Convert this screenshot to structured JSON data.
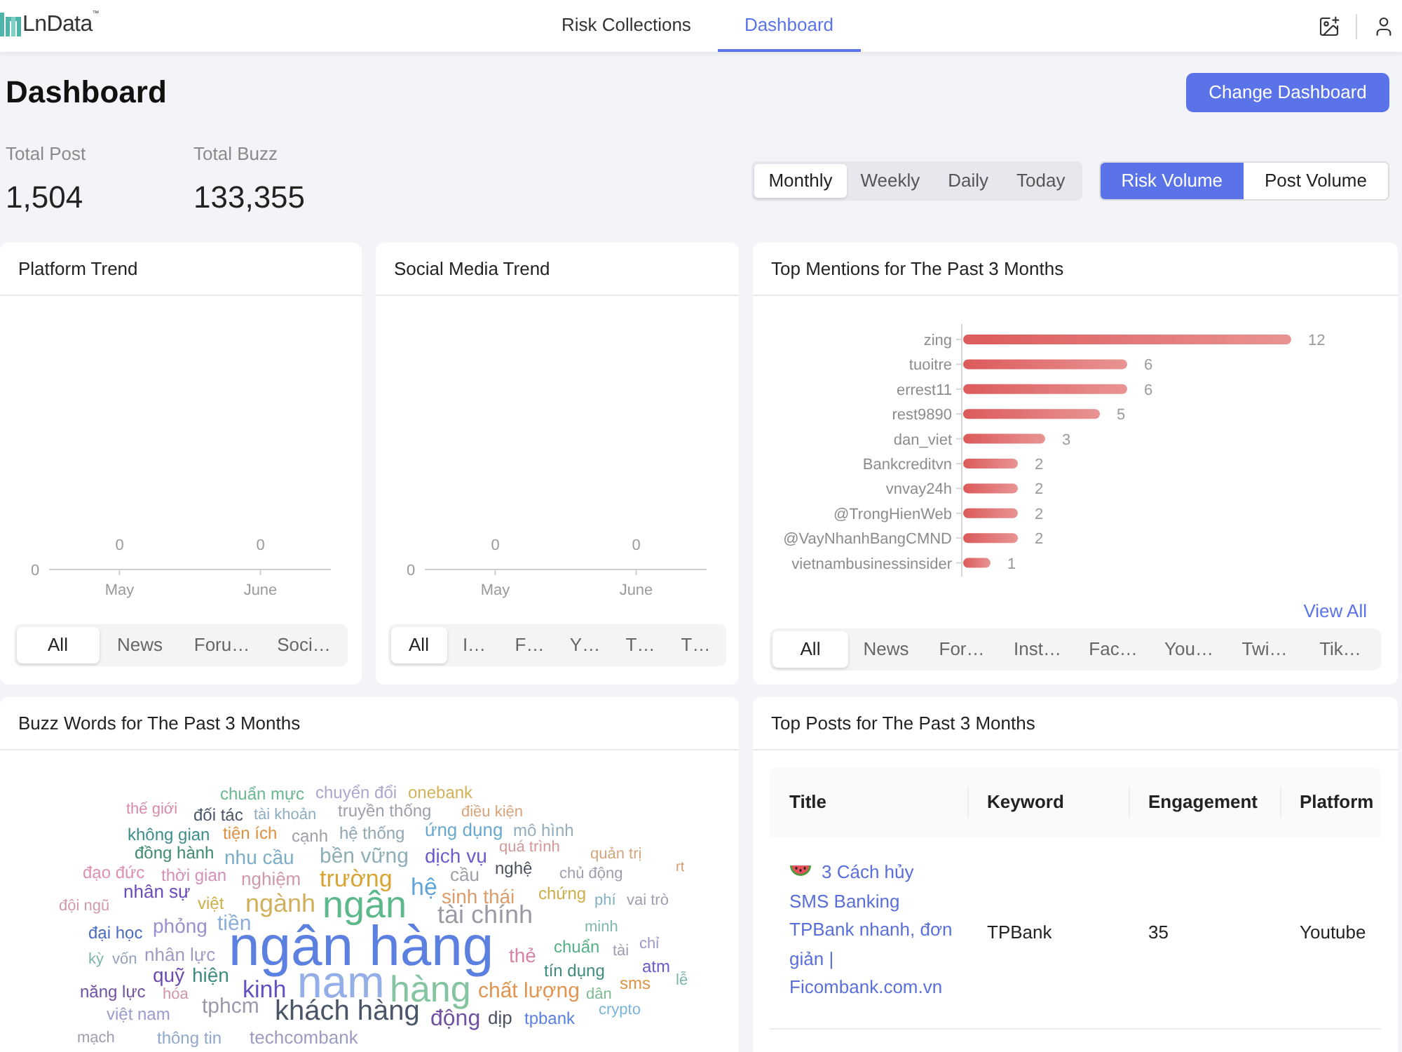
{
  "header": {
    "logo": "LnData$^{™}$",
    "nav": [
      {
        "label": "Risk Collections",
        "selected": false
      },
      {
        "label": "Dashboard",
        "selected": true
      }
    ]
  },
  "title": "Dashboard",
  "change_button": "Change Dashboard",
  "stats": [
    {
      "label": "Total Post",
      "value": "1,504"
    },
    {
      "label": "Total Buzz",
      "value": "133,355"
    }
  ],
  "period_tabs": [
    {
      "label": "Monthly",
      "selected": true
    },
    {
      "label": "Weekly",
      "selected": false
    },
    {
      "label": "Daily",
      "selected": false
    },
    {
      "label": "Today",
      "selected": false
    }
  ],
  "metric_tabs": [
    {
      "label": "Risk Volume",
      "selected": true
    },
    {
      "label": "Post Volume",
      "selected": false
    }
  ],
  "platform_trend": {
    "title": "Platform Trend",
    "plot": {
      "y_axis_label": "0",
      "points": [
        {
          "label": "May",
          "value": "0"
        },
        {
          "label": "June",
          "value": "0"
        }
      ]
    },
    "filters": [
      {
        "label": "All",
        "selected": true
      },
      {
        "label": "News",
        "selected": false
      },
      {
        "label": "Foru…",
        "selected": false
      },
      {
        "label": "Soci…",
        "selected": false
      }
    ]
  },
  "social_media_trend": {
    "title": "Social Media Trend",
    "plot": {
      "y_axis_label": "0",
      "points": [
        {
          "label": "May",
          "value": "0"
        },
        {
          "label": "June",
          "value": "0"
        }
      ]
    },
    "filters": [
      {
        "label": "All",
        "selected": true
      },
      {
        "label": "I…",
        "selected": false
      },
      {
        "label": "F…",
        "selected": false
      },
      {
        "label": "Y…",
        "selected": false
      },
      {
        "label": "T…",
        "selected": false
      },
      {
        "label": "T…",
        "selected": false
      }
    ]
  },
  "top_mentions": {
    "title": "Top Mentions for The Past 3 Months",
    "chart_data": {
      "type": "bar",
      "orientation": "horizontal",
      "categories": [
        "zing",
        "tuoitre",
        "errest11",
        "rest9890",
        "dan_viet",
        "Bankcreditvn",
        "vnvay24h",
        "@TrongHienWeb",
        "@VayNhanhBangCMND",
        "vietnambusinessinsider"
      ],
      "values": [
        12,
        6,
        6,
        5,
        3,
        2,
        2,
        2,
        2,
        1
      ],
      "data_labels": true,
      "color": "#dc5a5a"
    },
    "view_all": "View All",
    "filters": [
      {
        "label": "All",
        "selected": true
      },
      {
        "label": "News",
        "selected": false
      },
      {
        "label": "For…",
        "selected": false
      },
      {
        "label": "Inst…",
        "selected": false
      },
      {
        "label": "Fac…",
        "selected": false
      },
      {
        "label": "You…",
        "selected": false
      },
      {
        "label": "Twi…",
        "selected": false
      },
      {
        "label": "Tik…",
        "selected": false
      }
    ]
  },
  "buzz_words": {
    "title": "Buzz Words for The Past 3 Months",
    "words": [
      {
        "text": "chuẩn mực",
        "color": "#6cb890"
      },
      {
        "text": "chuyển đổi",
        "color": "#a9a8cc"
      },
      {
        "text": "onebank",
        "color": "#d4b258"
      },
      {
        "text": "thế giới",
        "color": "#d88aa8"
      },
      {
        "text": "đối tác",
        "color": "#4b5567"
      },
      {
        "text": "tài khoản",
        "color": "#8eacc2"
      },
      {
        "text": "truyền thống",
        "color": "#9da1aa"
      },
      {
        "text": "điều kiện",
        "color": "#d8a47a"
      },
      {
        "text": "không gian",
        "color": "#3f8c8c"
      },
      {
        "text": "tiện ích",
        "color": "#e0903f"
      },
      {
        "text": "cạnh",
        "color": "#a0a0a8"
      },
      {
        "text": "hệ thống",
        "color": "#90a8b4"
      },
      {
        "text": "ứng dụng",
        "color": "#69a9cf"
      },
      {
        "text": "mô hình",
        "color": "#94acbc"
      },
      {
        "text": "đồng hành",
        "color": "#3d8a72"
      },
      {
        "text": "nhu cầu",
        "color": "#7aaec8"
      },
      {
        "text": "bền vững",
        "color": "#8eaeb8"
      },
      {
        "text": "dịch vụ",
        "color": "#6b5bcd"
      },
      {
        "text": "quá trình",
        "color": "#d49898"
      },
      {
        "text": "quản trị",
        "color": "#d4a57a"
      },
      {
        "text": "đạo đức",
        "color": "#dc90b2"
      },
      {
        "text": "thời gian",
        "color": "#d490bc"
      },
      {
        "text": "nghiệm",
        "color": "#d098ac"
      },
      {
        "text": "trường",
        "color": "#d8a534"
      },
      {
        "text": "hệ",
        "color": "#61a5d8"
      },
      {
        "text": "cầu",
        "color": "#a0a0a8"
      },
      {
        "text": "nghệ",
        "color": "#4b5161"
      },
      {
        "text": "chủ động",
        "color": "#9e9eae"
      },
      {
        "text": "rt",
        "color": "#d49c6c"
      },
      {
        "text": "nhân sự",
        "color": "#6a4bb9"
      },
      {
        "text": "đội ngũ",
        "color": "#d498ae"
      },
      {
        "text": "việt",
        "color": "#ccb04c"
      },
      {
        "text": "ngành",
        "color": "#d0b05c"
      },
      {
        "text": "ngân",
        "color": "#5db98b"
      },
      {
        "text": "sinh thái",
        "color": "#dc9c6c"
      },
      {
        "text": "chứng",
        "color": "#ccae4c"
      },
      {
        "text": "phí",
        "color": "#84b0c2"
      },
      {
        "text": "vai trò",
        "color": "#9e9eae"
      },
      {
        "text": "tài chính",
        "color": "#9a9aa4"
      },
      {
        "text": "đại học",
        "color": "#4b6bc1"
      },
      {
        "text": "phỏng",
        "color": "#9c90cc"
      },
      {
        "text": "tiền",
        "color": "#8aaed8"
      },
      {
        "text": "ngân hàng",
        "color": "#5c80e0"
      },
      {
        "text": "minh",
        "color": "#7cb8ae"
      },
      {
        "text": "kỳ",
        "color": "#7cb6aa"
      },
      {
        "text": "vốn",
        "color": "#94a0ba"
      },
      {
        "text": "nhân lực",
        "color": "#9c9cc2"
      },
      {
        "text": "thẻ",
        "color": "#d884a6"
      },
      {
        "text": "chuẩn",
        "color": "#55b088"
      },
      {
        "text": "tài",
        "color": "#9e9eae"
      },
      {
        "text": "chỉ",
        "color": "#9a9ac8"
      },
      {
        "text": "quỹ",
        "color": "#6b4bb1"
      },
      {
        "text": "hiện",
        "color": "#3d8b81"
      },
      {
        "text": "nam",
        "color": "#94aee8"
      },
      {
        "text": "tín dụng",
        "color": "#3d8b81"
      },
      {
        "text": "atm",
        "color": "#6b5bc9"
      },
      {
        "text": "sms",
        "color": "#e09540"
      },
      {
        "text": "lễ",
        "color": "#7cb6aa"
      },
      {
        "text": "năng lực",
        "color": "#7151a1"
      },
      {
        "text": "hóa",
        "color": "#d494a6"
      },
      {
        "text": "kinh",
        "color": "#6151c1"
      },
      {
        "text": "hàng",
        "color": "#84c4a0"
      },
      {
        "text": "chất lượng",
        "color": "#e09550"
      },
      {
        "text": "dân",
        "color": "#7cbc92"
      },
      {
        "text": "việt nam",
        "color": "#9c9cce"
      },
      {
        "text": "tphcm",
        "color": "#9a9aae"
      },
      {
        "text": "khách hàng",
        "color": "#4b5569"
      },
      {
        "text": "động",
        "color": "#7151a1"
      },
      {
        "text": "dịp",
        "color": "#4b5161"
      },
      {
        "text": "tpbank",
        "color": "#5c80e0"
      },
      {
        "text": "crypto",
        "color": "#78b4d8"
      },
      {
        "text": "mạch",
        "color": "#9e9eae"
      },
      {
        "text": "thông tin",
        "color": "#90a8ca"
      },
      {
        "text": "techcombank",
        "color": "#9c9cc2"
      }
    ]
  },
  "top_posts": {
    "title": "Top Posts for The Past 3 Months",
    "columns": [
      "Title",
      "Keyword",
      "Engagement",
      "Platform"
    ],
    "rows": [
      {
        "title": "3 Cách hủy SMS Banking TPBank nhanh, đơn giản | Ficombank.com.vn",
        "keyword": "TPBank",
        "engagement": "35",
        "platform": "Youtube"
      }
    ]
  }
}
